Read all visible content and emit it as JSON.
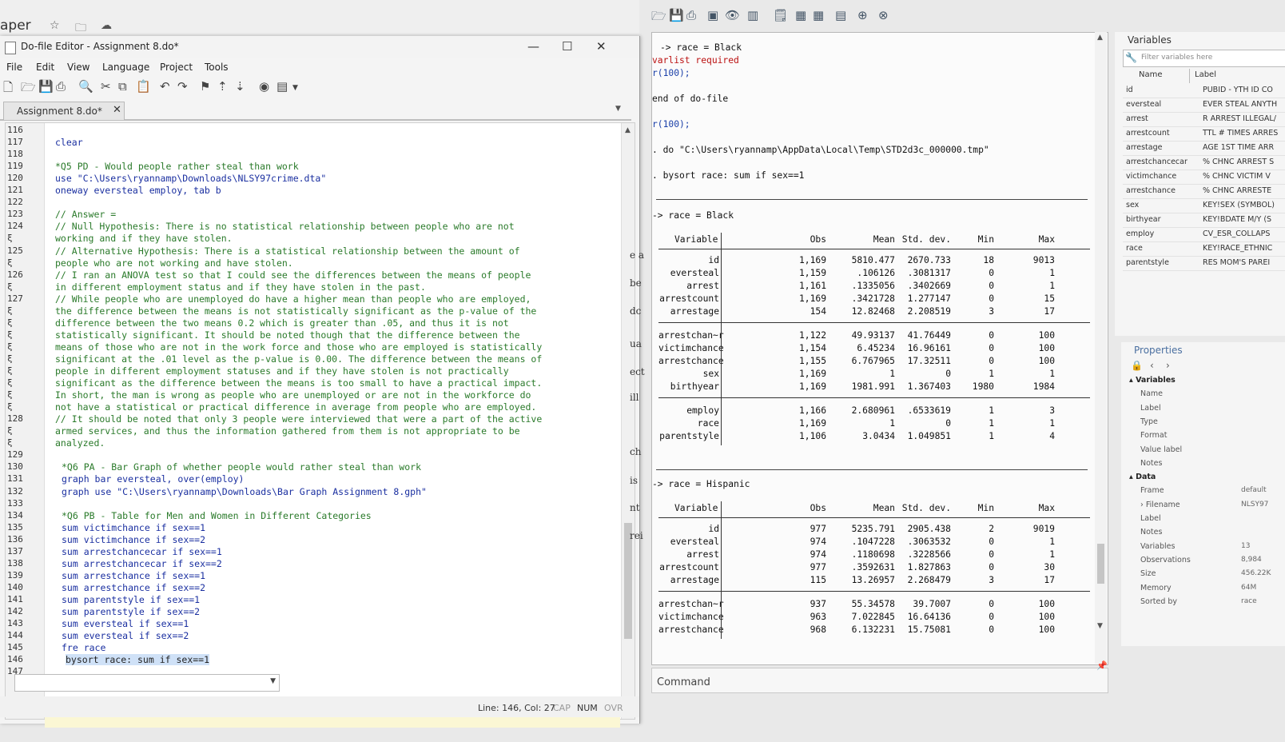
{
  "top": {
    "app_title": "aper",
    "star_icon": "star-icon",
    "folder_icon": "folder-icon",
    "cloud_icon": "cloud-icon"
  },
  "dofile": {
    "window_title": "Do-file Editor - Assignment 8.do*",
    "menu": [
      "File",
      "Edit",
      "View",
      "Language",
      "Project",
      "Tools"
    ],
    "tab_label": "Assignment 8.do*",
    "status": {
      "position": "Line: 146, Col: 27",
      "cap": "CAP",
      "num": "NUM",
      "ovr": "OVR"
    },
    "lines": [
      {
        "n": "116",
        "t": ""
      },
      {
        "n": "117",
        "t": "clear",
        "k": "kw"
      },
      {
        "n": "118",
        "t": ""
      },
      {
        "n": "119",
        "t": "*Q5 PD - Would people rather steal than work",
        "k": "cm"
      },
      {
        "n": "120",
        "t": "use \"C:\\Users\\ryannamp\\Downloads\\NLSY97crime.dta\"",
        "k": "kw"
      },
      {
        "n": "121",
        "t": "oneway eversteal employ, tab b",
        "k": "kw"
      },
      {
        "n": "122",
        "t": ""
      },
      {
        "n": "123",
        "t": "// Answer =",
        "k": "cm"
      },
      {
        "n": "124",
        "t": "// Null Hypothesis: There is no statistical relationship between people who are not",
        "k": "cm"
      },
      {
        "n": "ξ",
        "t": "working and if they have stolen.",
        "k": "cm"
      },
      {
        "n": "125",
        "t": "// Alternative Hypothesis: There is a statistical relationship between the amount of",
        "k": "cm"
      },
      {
        "n": "ξ",
        "t": "people who are not working and have stolen.",
        "k": "cm"
      },
      {
        "n": "126",
        "t": "// I ran an ANOVA test so that I could see the differences between the means of people",
        "k": "cm"
      },
      {
        "n": "ξ",
        "t": "in different employment status and if they have stolen in the past.",
        "k": "cm"
      },
      {
        "n": "127",
        "t": "// While people who are unemployed do have a higher mean than people who are employed,",
        "k": "cm"
      },
      {
        "n": "ξ",
        "t": "the difference between the means is not statistically significant as the p-value of the",
        "k": "cm"
      },
      {
        "n": "ξ",
        "t": "difference between the two means 0.2 which is greater than .05, and thus it is not",
        "k": "cm"
      },
      {
        "n": "ξ",
        "t": "statistically significant. It should be noted though that the difference between the",
        "k": "cm"
      },
      {
        "n": "ξ",
        "t": "means of those who are not in the work force and those who are employed is statistically",
        "k": "cm"
      },
      {
        "n": "ξ",
        "t": "significant at the .01 level as the p-value is 0.00. The difference between the means of",
        "k": "cm"
      },
      {
        "n": "ξ",
        "t": "people in different employment statuses and if they have stolen is not practically",
        "k": "cm"
      },
      {
        "n": "ξ",
        "t": "significant as the difference between the means is too small to have a practical impact.",
        "k": "cm"
      },
      {
        "n": "ξ",
        "t": "In short, the man is wrong as people who are unemployed or are not in the workforce do",
        "k": "cm"
      },
      {
        "n": "ξ",
        "t": "not have a statistical or practical difference in average from people who are employed.",
        "k": "cm"
      },
      {
        "n": "128",
        "t": "// It should be noted that only 3 people were interviewed that were a part of the active",
        "k": "cm"
      },
      {
        "n": "ξ",
        "t": "armed services, and thus the information gathered from them is not appropriate to be",
        "k": "cm"
      },
      {
        "n": "ξ",
        "t": "analyzed.",
        "k": "cm"
      },
      {
        "n": "129",
        "t": ""
      },
      {
        "n": "130",
        "t": "*Q6 PA - Bar Graph of whether people would rather steal than work",
        "k": "cm"
      },
      {
        "n": "131",
        "t": "graph bar eversteal, over(employ)",
        "k": "kw"
      },
      {
        "n": "132",
        "t": "graph use \"C:\\Users\\ryannamp\\Downloads\\Bar Graph Assignment 8.gph\"",
        "k": "kw"
      },
      {
        "n": "133",
        "t": ""
      },
      {
        "n": "134",
        "t": "*Q6 PB - Table for Men and Women in Different Categories",
        "k": "cm"
      },
      {
        "n": "135",
        "t": "sum victimchance if sex==1",
        "k": "kw"
      },
      {
        "n": "136",
        "t": "sum victimchance if sex==2",
        "k": "kw"
      },
      {
        "n": "137",
        "t": "sum arrestchancecar if sex==1",
        "k": "kw"
      },
      {
        "n": "138",
        "t": "sum arrestchancecar if sex==2",
        "k": "kw"
      },
      {
        "n": "139",
        "t": "sum arrestchance if sex==1",
        "k": "kw"
      },
      {
        "n": "140",
        "t": "sum arrestchance if sex==2",
        "k": "kw"
      },
      {
        "n": "141",
        "t": "sum parentstyle if sex==1",
        "k": "kw"
      },
      {
        "n": "142",
        "t": "sum parentstyle if sex==2",
        "k": "kw"
      },
      {
        "n": "143",
        "t": "sum eversteal if sex==1",
        "k": "kw"
      },
      {
        "n": "144",
        "t": "sum eversteal if sex==2",
        "k": "kw"
      },
      {
        "n": "145",
        "t": "fre race",
        "k": "kw"
      },
      {
        "n": "146",
        "t": "bysort race: sum if sex==1",
        "k": "sel"
      },
      {
        "n": "147",
        "t": ""
      }
    ]
  },
  "midfragments": [
    "e a",
    "be",
    "dc",
    "ua",
    "ect",
    "ill",
    "ch",
    "is",
    "nt",
    "rei"
  ],
  "results": {
    "lines": [
      {
        "t": "-> race = Black",
        "k": ""
      },
      {
        "t": "varlist required",
        "k": "err"
      },
      {
        "t": "r(100);",
        "k": "blue"
      },
      {
        "t": "end of do-file",
        "k": ""
      },
      {
        "t": "r(100);",
        "k": "blue"
      },
      {
        "t": ". do \"C:\\Users\\ryannamp\\AppData\\Local\\Temp\\STD2d3c_000000.tmp\"",
        "k": ""
      },
      {
        "t": ". bysort race: sum if sex==1",
        "k": ""
      },
      {
        "t": "-> race = Black",
        "k": ""
      },
      {
        "t": "-> race = Hispanic",
        "k": ""
      }
    ],
    "headers": [
      "Variable",
      "Obs",
      "Mean",
      "Std. dev.",
      "Min",
      "Max"
    ],
    "black_rows": [
      [
        "id",
        "1,169",
        "5810.477",
        "2670.733",
        "18",
        "9013"
      ],
      [
        "eversteal",
        "1,159",
        ".106126",
        ".3081317",
        "0",
        "1"
      ],
      [
        "arrest",
        "1,161",
        ".1335056",
        ".3402669",
        "0",
        "1"
      ],
      [
        "arrestcount",
        "1,169",
        ".3421728",
        "1.277147",
        "0",
        "15"
      ],
      [
        "arrestage",
        "154",
        "12.82468",
        "2.208519",
        "3",
        "17"
      ],
      [
        "arrestchan~r",
        "1,122",
        "49.93137",
        "41.76449",
        "0",
        "100"
      ],
      [
        "victimchance",
        "1,154",
        "6.45234",
        "16.96161",
        "0",
        "100"
      ],
      [
        "arrestchance",
        "1,155",
        "6.767965",
        "17.32511",
        "0",
        "100"
      ],
      [
        "sex",
        "1,169",
        "1",
        "0",
        "1",
        "1"
      ],
      [
        "birthyear",
        "1,169",
        "1981.991",
        "1.367403",
        "1980",
        "1984"
      ],
      [
        "employ",
        "1,166",
        "2.680961",
        ".6533619",
        "1",
        "3"
      ],
      [
        "race",
        "1,169",
        "1",
        "0",
        "1",
        "1"
      ],
      [
        "parentstyle",
        "1,106",
        "3.0434",
        "1.049851",
        "1",
        "4"
      ]
    ],
    "hispanic_rows": [
      [
        "id",
        "977",
        "5235.791",
        "2905.438",
        "2",
        "9019"
      ],
      [
        "eversteal",
        "974",
        ".1047228",
        ".3063532",
        "0",
        "1"
      ],
      [
        "arrest",
        "974",
        ".1180698",
        ".3228566",
        "0",
        "1"
      ],
      [
        "arrestcount",
        "977",
        ".3592631",
        "1.827863",
        "0",
        "30"
      ],
      [
        "arrestage",
        "115",
        "13.26957",
        "2.268479",
        "3",
        "17"
      ],
      [
        "arrestchan~r",
        "937",
        "55.34578",
        "39.7007",
        "0",
        "100"
      ],
      [
        "victimchance",
        "963",
        "7.022845",
        "16.64136",
        "0",
        "100"
      ],
      [
        "arrestchance",
        "968",
        "6.132231",
        "15.75081",
        "0",
        "100"
      ]
    ],
    "command_label": "Command"
  },
  "variables": {
    "title": "Variables",
    "filter_placeholder": "Filter variables here",
    "col_name": "Name",
    "col_label": "Label",
    "rows": [
      [
        "id",
        "PUBID - YTH ID CO"
      ],
      [
        "eversteal",
        "EVER STEAL ANYTH"
      ],
      [
        "arrest",
        "R ARREST ILLEGAL/"
      ],
      [
        "arrestcount",
        "TTL # TIMES ARRES"
      ],
      [
        "arrestage",
        "AGE 1ST TIME ARR"
      ],
      [
        "arrestchancecar",
        "% CHNC ARREST S"
      ],
      [
        "victimchance",
        "% CHNC VICTIM V"
      ],
      [
        "arrestchance",
        "% CHNC ARRESTE"
      ],
      [
        "sex",
        "KEY!SEX (SYMBOL)"
      ],
      [
        "birthyear",
        "KEY!BDATE M/Y (S"
      ],
      [
        "employ",
        "CV_ESR_COLLAPS"
      ],
      [
        "race",
        "KEY!RACE_ETHNIC"
      ],
      [
        "parentstyle",
        "RES MOM'S PAREI"
      ]
    ]
  },
  "properties": {
    "title": "Properties",
    "rows": [
      {
        "k": "▴ Variables",
        "v": "",
        "sec": true
      },
      {
        "k": "Name",
        "v": ""
      },
      {
        "k": "Label",
        "v": ""
      },
      {
        "k": "Type",
        "v": ""
      },
      {
        "k": "Format",
        "v": ""
      },
      {
        "k": "Value label",
        "v": ""
      },
      {
        "k": "Notes",
        "v": ""
      },
      {
        "k": "▴ Data",
        "v": "",
        "sec": true
      },
      {
        "k": "Frame",
        "v": "default"
      },
      {
        "k": "› Filename",
        "v": "NLSY97"
      },
      {
        "k": "Label",
        "v": ""
      },
      {
        "k": "Notes",
        "v": ""
      },
      {
        "k": "Variables",
        "v": "13"
      },
      {
        "k": "Observations",
        "v": "8,984"
      },
      {
        "k": "Size",
        "v": "456.22K"
      },
      {
        "k": "Memory",
        "v": "64M"
      },
      {
        "k": "Sorted by",
        "v": "race"
      }
    ]
  }
}
